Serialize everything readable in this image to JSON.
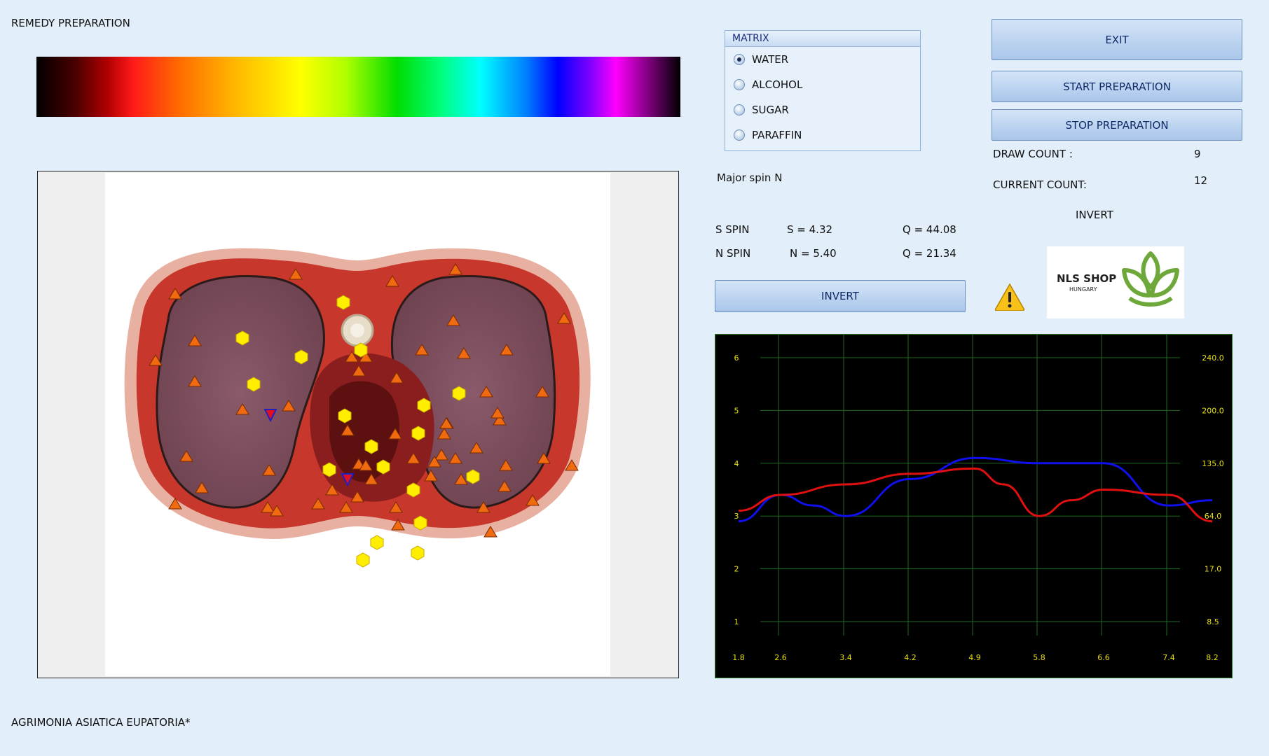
{
  "app": {
    "title": "REMEDY PREPARATION",
    "remedy_name": "AGRIMONIA  ASIATICA  EUPATORIA*"
  },
  "matrix": {
    "title": "MATRIX",
    "options": [
      {
        "label": "WATER",
        "selected": true
      },
      {
        "label": "ALCOHOL",
        "selected": false
      },
      {
        "label": "SUGAR",
        "selected": false
      },
      {
        "label": "PARAFFIN",
        "selected": false
      }
    ]
  },
  "buttons": {
    "exit": "EXIT",
    "start": "START PREPARATION",
    "stop": "STOP PREPARATION",
    "invert": "INVERT"
  },
  "counts": {
    "draw_label": "DRAW COUNT :",
    "draw_value": "9",
    "current_label": "CURRENT COUNT:",
    "current_value": "12"
  },
  "invert_label": "INVERT",
  "spin": {
    "major": "Major spin N",
    "s_label": "S SPIN",
    "s_value": "S = 4.32",
    "s_q": "Q = 44.08",
    "n_label": "N SPIN",
    "n_value": "N = 5.40",
    "n_q": "Q = 21.34"
  },
  "logo": {
    "name": "NLS SHOP",
    "sub": "HUNGARY",
    "color": "#6fa83a"
  },
  "icons": {
    "warning": "warning-icon"
  },
  "chart_data": {
    "type": "line",
    "x_ticks": [
      "1.8",
      "2.6",
      "3.4",
      "4.2",
      "4.9",
      "5.8",
      "6.6",
      "7.4",
      "8.2"
    ],
    "y_ticks_left": [
      "1",
      "2",
      "3",
      "4",
      "5",
      "6"
    ],
    "y_ticks_right": [
      "8.5",
      "17.0",
      "64.0",
      "135.0",
      "200.0",
      "240.0"
    ],
    "ylim": [
      0.5,
      6.5
    ],
    "grid": true,
    "series": [
      {
        "color": "#1010ee",
        "x": [
          1.8,
          2.6,
          3.0,
          3.4,
          4.2,
          4.9,
          5.8,
          6.6,
          7.4,
          8.2
        ],
        "y": [
          2.9,
          3.4,
          3.2,
          3.0,
          3.7,
          4.1,
          4.0,
          4.0,
          3.2,
          3.3
        ]
      },
      {
        "color": "#e01010",
        "x": [
          1.8,
          2.6,
          3.4,
          4.2,
          4.9,
          5.3,
          5.8,
          6.2,
          6.6,
          7.4,
          8.2
        ],
        "y": [
          3.1,
          3.4,
          3.6,
          3.8,
          3.9,
          3.6,
          3.0,
          3.3,
          3.5,
          3.4,
          2.9
        ]
      }
    ]
  }
}
